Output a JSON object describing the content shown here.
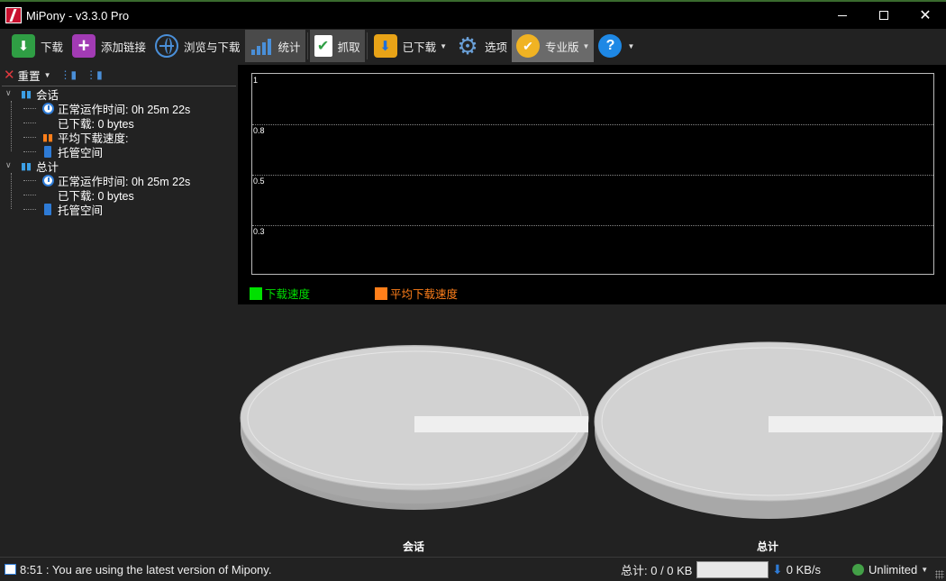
{
  "window": {
    "title": "MiPony - v3.3.0 Pro",
    "minimize_icon": "minimize-icon",
    "maximize_icon": "maximize-icon",
    "close_icon": "close-icon"
  },
  "toolbar": {
    "download": "下载",
    "add_link": "添加链接",
    "browse_download": "浏览与下载",
    "stats": "统计",
    "grab": "抓取",
    "downloaded": "已下载",
    "options": "选项",
    "pro": "专业版",
    "help_glyph": "?"
  },
  "tree": {
    "reset_label": "重置",
    "session": {
      "label": "会话",
      "uptime": "正常运作时间: 0h 25m 22s",
      "downloaded": "已下载: 0 bytes",
      "avg_speed": "平均下载速度:",
      "hosted_space": "托管空间"
    },
    "total": {
      "label": "总计",
      "uptime": "正常运作时间: 0h 25m 22s",
      "downloaded": "已下载: 0 bytes",
      "hosted_space": "托管空间"
    }
  },
  "chart_data": [
    {
      "type": "line",
      "title": "",
      "xlabel": "",
      "ylabel": "",
      "y_ticks": [
        "1",
        "0.8",
        "0.5",
        "0.3"
      ],
      "series": [
        {
          "name": "下载速度",
          "color": "#00e000",
          "values": []
        },
        {
          "name": "平均下载速度",
          "color": "#ff7f1a",
          "values": []
        }
      ],
      "legend_position": "bottom-left",
      "grid": true
    },
    {
      "type": "pie",
      "title": "会话",
      "slices": []
    },
    {
      "type": "pie",
      "title": "总计",
      "slices": []
    }
  ],
  "statusbar": {
    "message": "8:51 : You are using the latest version of Mipony.",
    "total": "总计: 0 / 0 KB",
    "speed": "0 KB/s",
    "limit": "Unlimited",
    "progress": 0
  }
}
